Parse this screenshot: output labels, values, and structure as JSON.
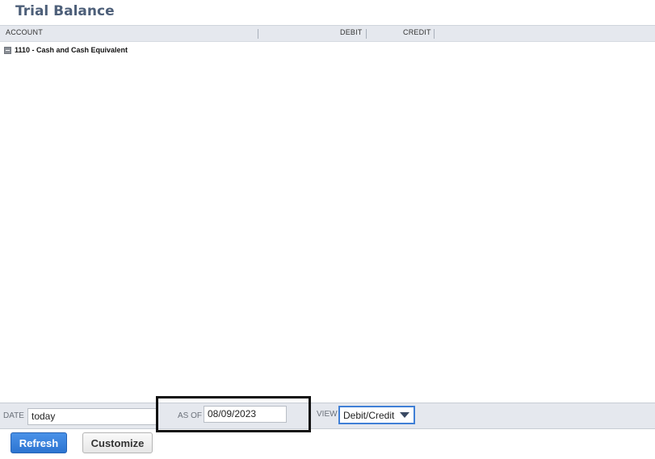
{
  "page": {
    "title": "Trial Balance"
  },
  "report": {
    "columns": [
      "ACCOUNT",
      "DEBIT",
      "CREDIT"
    ],
    "rows": [
      {
        "label": "1110 - Cash and Cash Equivalent",
        "expanded": true
      }
    ]
  },
  "filters": {
    "date_label": "DATE",
    "date_value": "today",
    "as_of_label": "AS OF",
    "as_of_value": "08/09/2023",
    "view_label": "VIEW",
    "view_value": "Debit/Credit"
  },
  "actions": {
    "refresh_label": "Refresh",
    "customize_label": "Customize"
  },
  "colors": {
    "title": "#4d5f79",
    "header_bg": "#e5e8ee",
    "primary_button": "#2c74d1",
    "select_focus": "#3f7fd6"
  },
  "icons": {
    "collapse": "minus-square-icon",
    "dropdown": "caret-down-icon"
  }
}
